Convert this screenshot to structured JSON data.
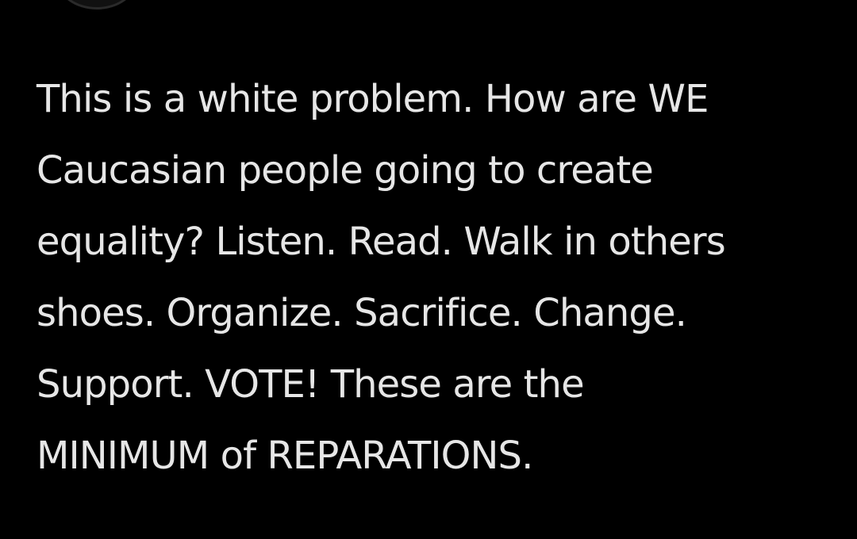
{
  "post": {
    "lines": [
      "This is a white problem. How are WE",
      "Caucasian people going to create",
      "equality? Listen. Read. Walk in others",
      "shoes. Organize. Sacrifice. Change.",
      "Support. VOTE! These are the",
      "MINIMUM of REPARATIONS."
    ]
  }
}
